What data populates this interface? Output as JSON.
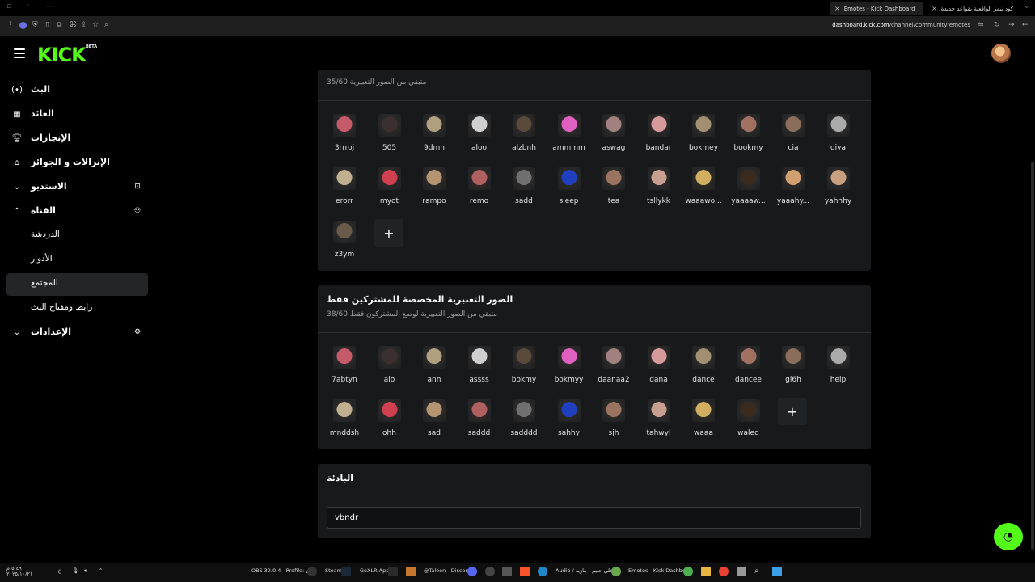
{
  "browser": {
    "tabs": [
      {
        "title": "Emotes - Kick Dashboard",
        "active": true
      },
      {
        "title": "كود نيمز الواقعية بقواعد جديدة",
        "active": false
      }
    ],
    "url_host": "dashboard.kick.com",
    "url_path": "/channel/community/emotes"
  },
  "header": {
    "logo": "KICK",
    "beta": "BETA"
  },
  "sidebar": {
    "items": [
      {
        "label": "البث",
        "icon": "broadcast-icon"
      },
      {
        "label": "العائد",
        "icon": "revenue-icon"
      },
      {
        "label": "الإنجازات",
        "icon": "trophy-icon"
      },
      {
        "label": "الإنزالات و الجوائز",
        "icon": "gift-icon"
      },
      {
        "label": "الاستديو",
        "icon": "chevron-down-icon"
      },
      {
        "label": "القناة",
        "icon": "chevron-up-icon"
      },
      {
        "label": "الدردشة"
      },
      {
        "label": "الأدوار"
      },
      {
        "label": "المجتمع"
      },
      {
        "label": "رابط ومفتاح البث"
      },
      {
        "label": "الإعدادات",
        "icon": "chevron-down-icon"
      }
    ]
  },
  "panels": {
    "channel_emotes": {
      "subtitle": "متبقي من الصور التعبيرية 35/60",
      "emotes": [
        "3rrroj",
        "505",
        "9dmh",
        "aloo",
        "alzbnh",
        "ammmm",
        "aswag",
        "bandar",
        "bokmey",
        "bookmy",
        "cia",
        "diva",
        "erorr",
        "myot",
        "rampo",
        "remo",
        "sadd",
        "sleep",
        "tea",
        "tsllykk",
        "waaawo...",
        "yaaaaw...",
        "yaaahy...",
        "yahhhy",
        "z3ym"
      ]
    },
    "subscriber_emotes": {
      "title": "الصور التعبيرية المخصصة للمشتركين فقط",
      "subtitle": "متبقي من الصور التعبيرية لوضع المشتركون فقط 38/60",
      "emotes": [
        "7abtyn",
        "alo",
        "ann",
        "assss",
        "bokmy",
        "bokmyy",
        "daanaa2",
        "dana",
        "dance",
        "dancee",
        "gl6h",
        "help",
        "mnddsh",
        "ohh",
        "sad",
        "saddd",
        "sadddd",
        "sahhy",
        "sjh",
        "tahwyl",
        "waaa",
        "waled"
      ]
    },
    "prefix": {
      "title": "البادئة",
      "value": "vbndr"
    }
  },
  "colors": {
    "accent": "#53fc18",
    "panel": "#17191a",
    "background": "#000000"
  },
  "taskbar": {
    "items": [
      "OBS 32.0.4 - Profile: بدون",
      "Steam",
      "GoXLR App",
      "@Taleen - Discord",
      "Audio / علي حليم - مازيد",
      "Emotes - Kick Dashboa"
    ],
    "clock_time": "٥:٤٩ م",
    "clock_date": "٢٠٢٥/١٠/٢١"
  }
}
